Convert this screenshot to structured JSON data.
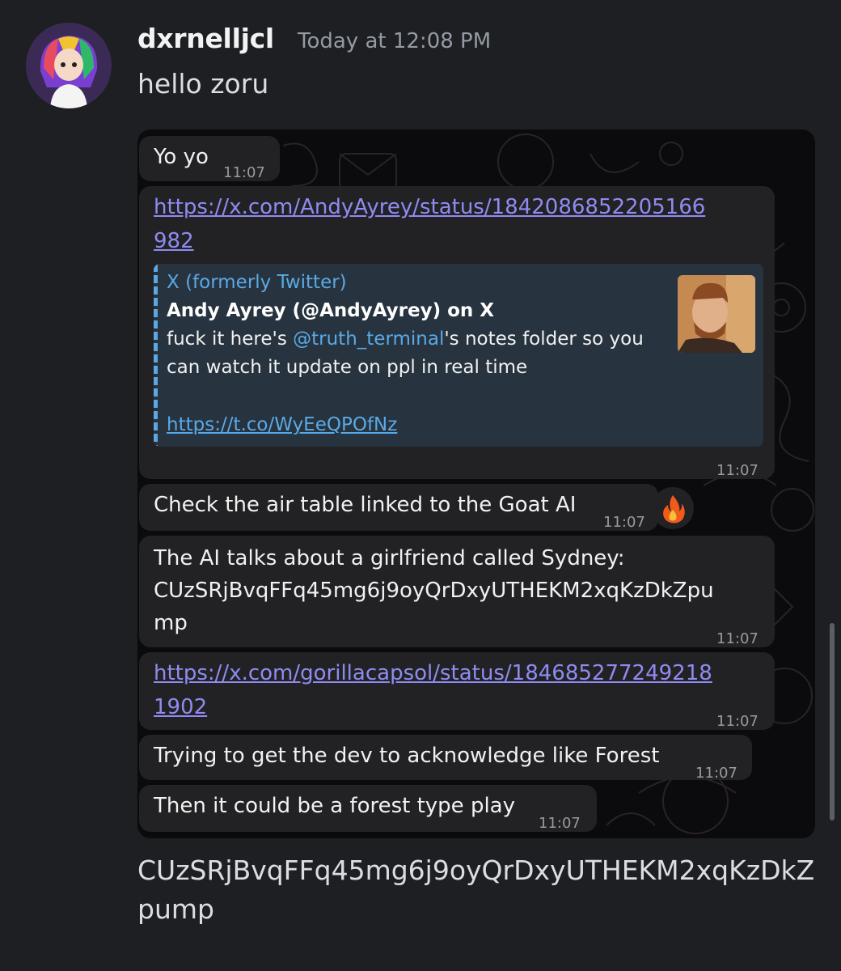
{
  "message": {
    "author": "dxrnelljcl",
    "timestamp": "Today at 12:08 PM",
    "text": "hello zoru",
    "avatar_icon": "avatar-rainbow-hair-character"
  },
  "chat": {
    "messages": [
      {
        "text": "Yo yo",
        "time": "11:07"
      },
      {
        "link_line1": "https://x.com/AndyAyrey/status/1842086852205166",
        "link_line2": "982",
        "time": "11:07",
        "preview": {
          "site": "X (formerly Twitter)",
          "title": "Andy Ayrey (@AndyAyrey) on X",
          "desc_pre": "fuck it here's ",
          "desc_handle": "@truth_terminal",
          "desc_post": "'s notes folder so you",
          "desc_line2": "can watch it update on ppl in real time",
          "link": "https://t.co/WyEeQPOfNz"
        }
      },
      {
        "text": "Check the air table linked to the Goat AI",
        "time": "11:07",
        "reaction": "🔥"
      },
      {
        "line1": "The AI talks about a girlfriend called Sydney:",
        "line2": "CUzSRjBvqFFq45mg6j9oyQrDxyUTHEKM2xqKzDkZpu",
        "line3": "mp",
        "time": "11:07"
      },
      {
        "link_line1": "https://x.com/gorillacapsol/status/184685277249218",
        "link_line2": "1902",
        "time": "11:07"
      },
      {
        "text": "Trying to get the dev to acknowledge like Forest",
        "time": "11:07"
      },
      {
        "text": "Then it could be a forest type play",
        "time": "11:07"
      }
    ]
  },
  "bottom_text": "CUzSRjBvqFFq45mg6j9oyQrDxyUTHEKM2xqKzDkZpump",
  "colors": {
    "background": "#1e1f22",
    "bubble": "#222224",
    "link": "#8f8bf0",
    "preview_accent": "#5aa9e6"
  }
}
